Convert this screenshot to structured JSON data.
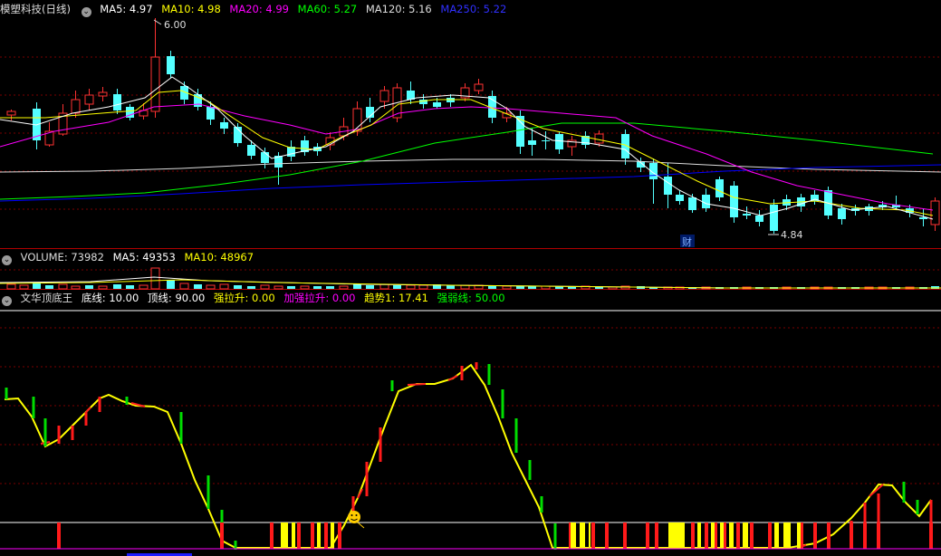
{
  "main_panel": {
    "title": "模塑科技(日线)",
    "ma": [
      {
        "label": "MA5: 4.97",
        "color": "#ffffff"
      },
      {
        "label": "MA10: 4.98",
        "color": "#ffff00"
      },
      {
        "label": "MA20: 4.99",
        "color": "#ff00ff"
      },
      {
        "label": "MA60: 5.27",
        "color": "#00ff00"
      },
      {
        "label": "MA120: 5.16",
        "color": "#dddddd"
      },
      {
        "label": "MA250: 5.22",
        "color": "#0000ff"
      }
    ],
    "high_label": "6.00",
    "low_label": "4.84",
    "event_badge": "财",
    "colors": {
      "up": "#ff3232",
      "down": "#54ffff",
      "ma5": "#ffffff",
      "ma10": "#ffff00",
      "ma20": "#ff00ff",
      "ma60": "#00ff00",
      "ma120": "#dddddd",
      "ma250": "#0000ff"
    }
  },
  "volume_panel": {
    "title": "VOLUME: 73982",
    "ma5": "MA5: 49353",
    "ma10": "MA10: 48967"
  },
  "indicator_panel": {
    "title": "文华顶底王",
    "items": [
      {
        "label": "底线: 10.00",
        "color": "#ffffff"
      },
      {
        "label": "顶线: 90.00",
        "color": "#ffffff"
      },
      {
        "label": "强拉升: 0.00",
        "color": "#ffff00"
      },
      {
        "label": "加强拉升: 0.00",
        "color": "#ff00ff"
      },
      {
        "label": "趋势1: 17.41",
        "color": "#ffff00"
      },
      {
        "label": "强弱线: 50.00",
        "color": "#00ff00"
      }
    ]
  }
}
